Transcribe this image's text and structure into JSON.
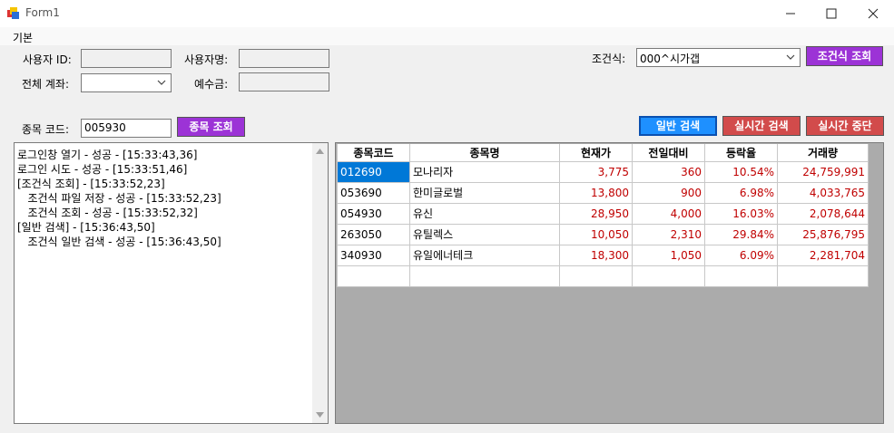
{
  "window": {
    "title": "Form1"
  },
  "menu": {
    "items": [
      "기본"
    ]
  },
  "form": {
    "user_id_label": "사용자 ID:",
    "user_id_value": "",
    "user_name_label": "사용자명:",
    "user_name_value": "",
    "account_label": "전체 계좌:",
    "account_value": "",
    "deposit_label": "예수금:",
    "deposit_value": "",
    "condition_label": "조건식:",
    "condition_value": "000^시가갭",
    "condition_search_button": "조건식 조회",
    "stock_code_label": "종목 코드:",
    "stock_code_value": "005930",
    "stock_search_button": "종목 조회",
    "normal_search_button": "일반 검색",
    "realtime_search_button": "실시간 검색",
    "realtime_stop_button": "실시간 중단"
  },
  "log": {
    "lines": [
      "로그인창 열기 - 성공 - [15:33:43,36]",
      "로그인 시도 - 성공 - [15:33:51,46]",
      "[조건식 조회] - [15:33:52,23]",
      "   조건식 파일 저장 - 성공 - [15:33:52,23]",
      "   조건식 조회 - 성공 - [15:33:52,32]",
      "[일반 검색] - [15:36:43,50]",
      "   조건식 일반 검색 - 성공 - [15:36:43,50]"
    ]
  },
  "grid": {
    "columns": [
      "종목코드",
      "종목명",
      "현재가",
      "전일대비",
      "등락율",
      "거래량"
    ],
    "rows": [
      [
        "012690",
        "모나리자",
        "3,775",
        "360",
        "10.54%",
        "24,759,991"
      ],
      [
        "053690",
        "한미글로벌",
        "13,800",
        "900",
        "6.98%",
        "4,033,765"
      ],
      [
        "054930",
        "유신",
        "28,950",
        "4,000",
        "16.03%",
        "2,078,644"
      ],
      [
        "263050",
        "유틸렉스",
        "10,050",
        "2,310",
        "29.84%",
        "25,876,795"
      ],
      [
        "340930",
        "유일에너테크",
        "18,300",
        "1,050",
        "6.09%",
        "2,281,704"
      ],
      [
        "",
        "",
        "",
        "",
        "",
        ""
      ]
    ]
  },
  "colors": {
    "purple_button": "#9c33d6",
    "blue_button": "#1e90ff",
    "red_button": "#d24b4b",
    "selection": "#0078d7",
    "numeric_text": "#c00000"
  }
}
